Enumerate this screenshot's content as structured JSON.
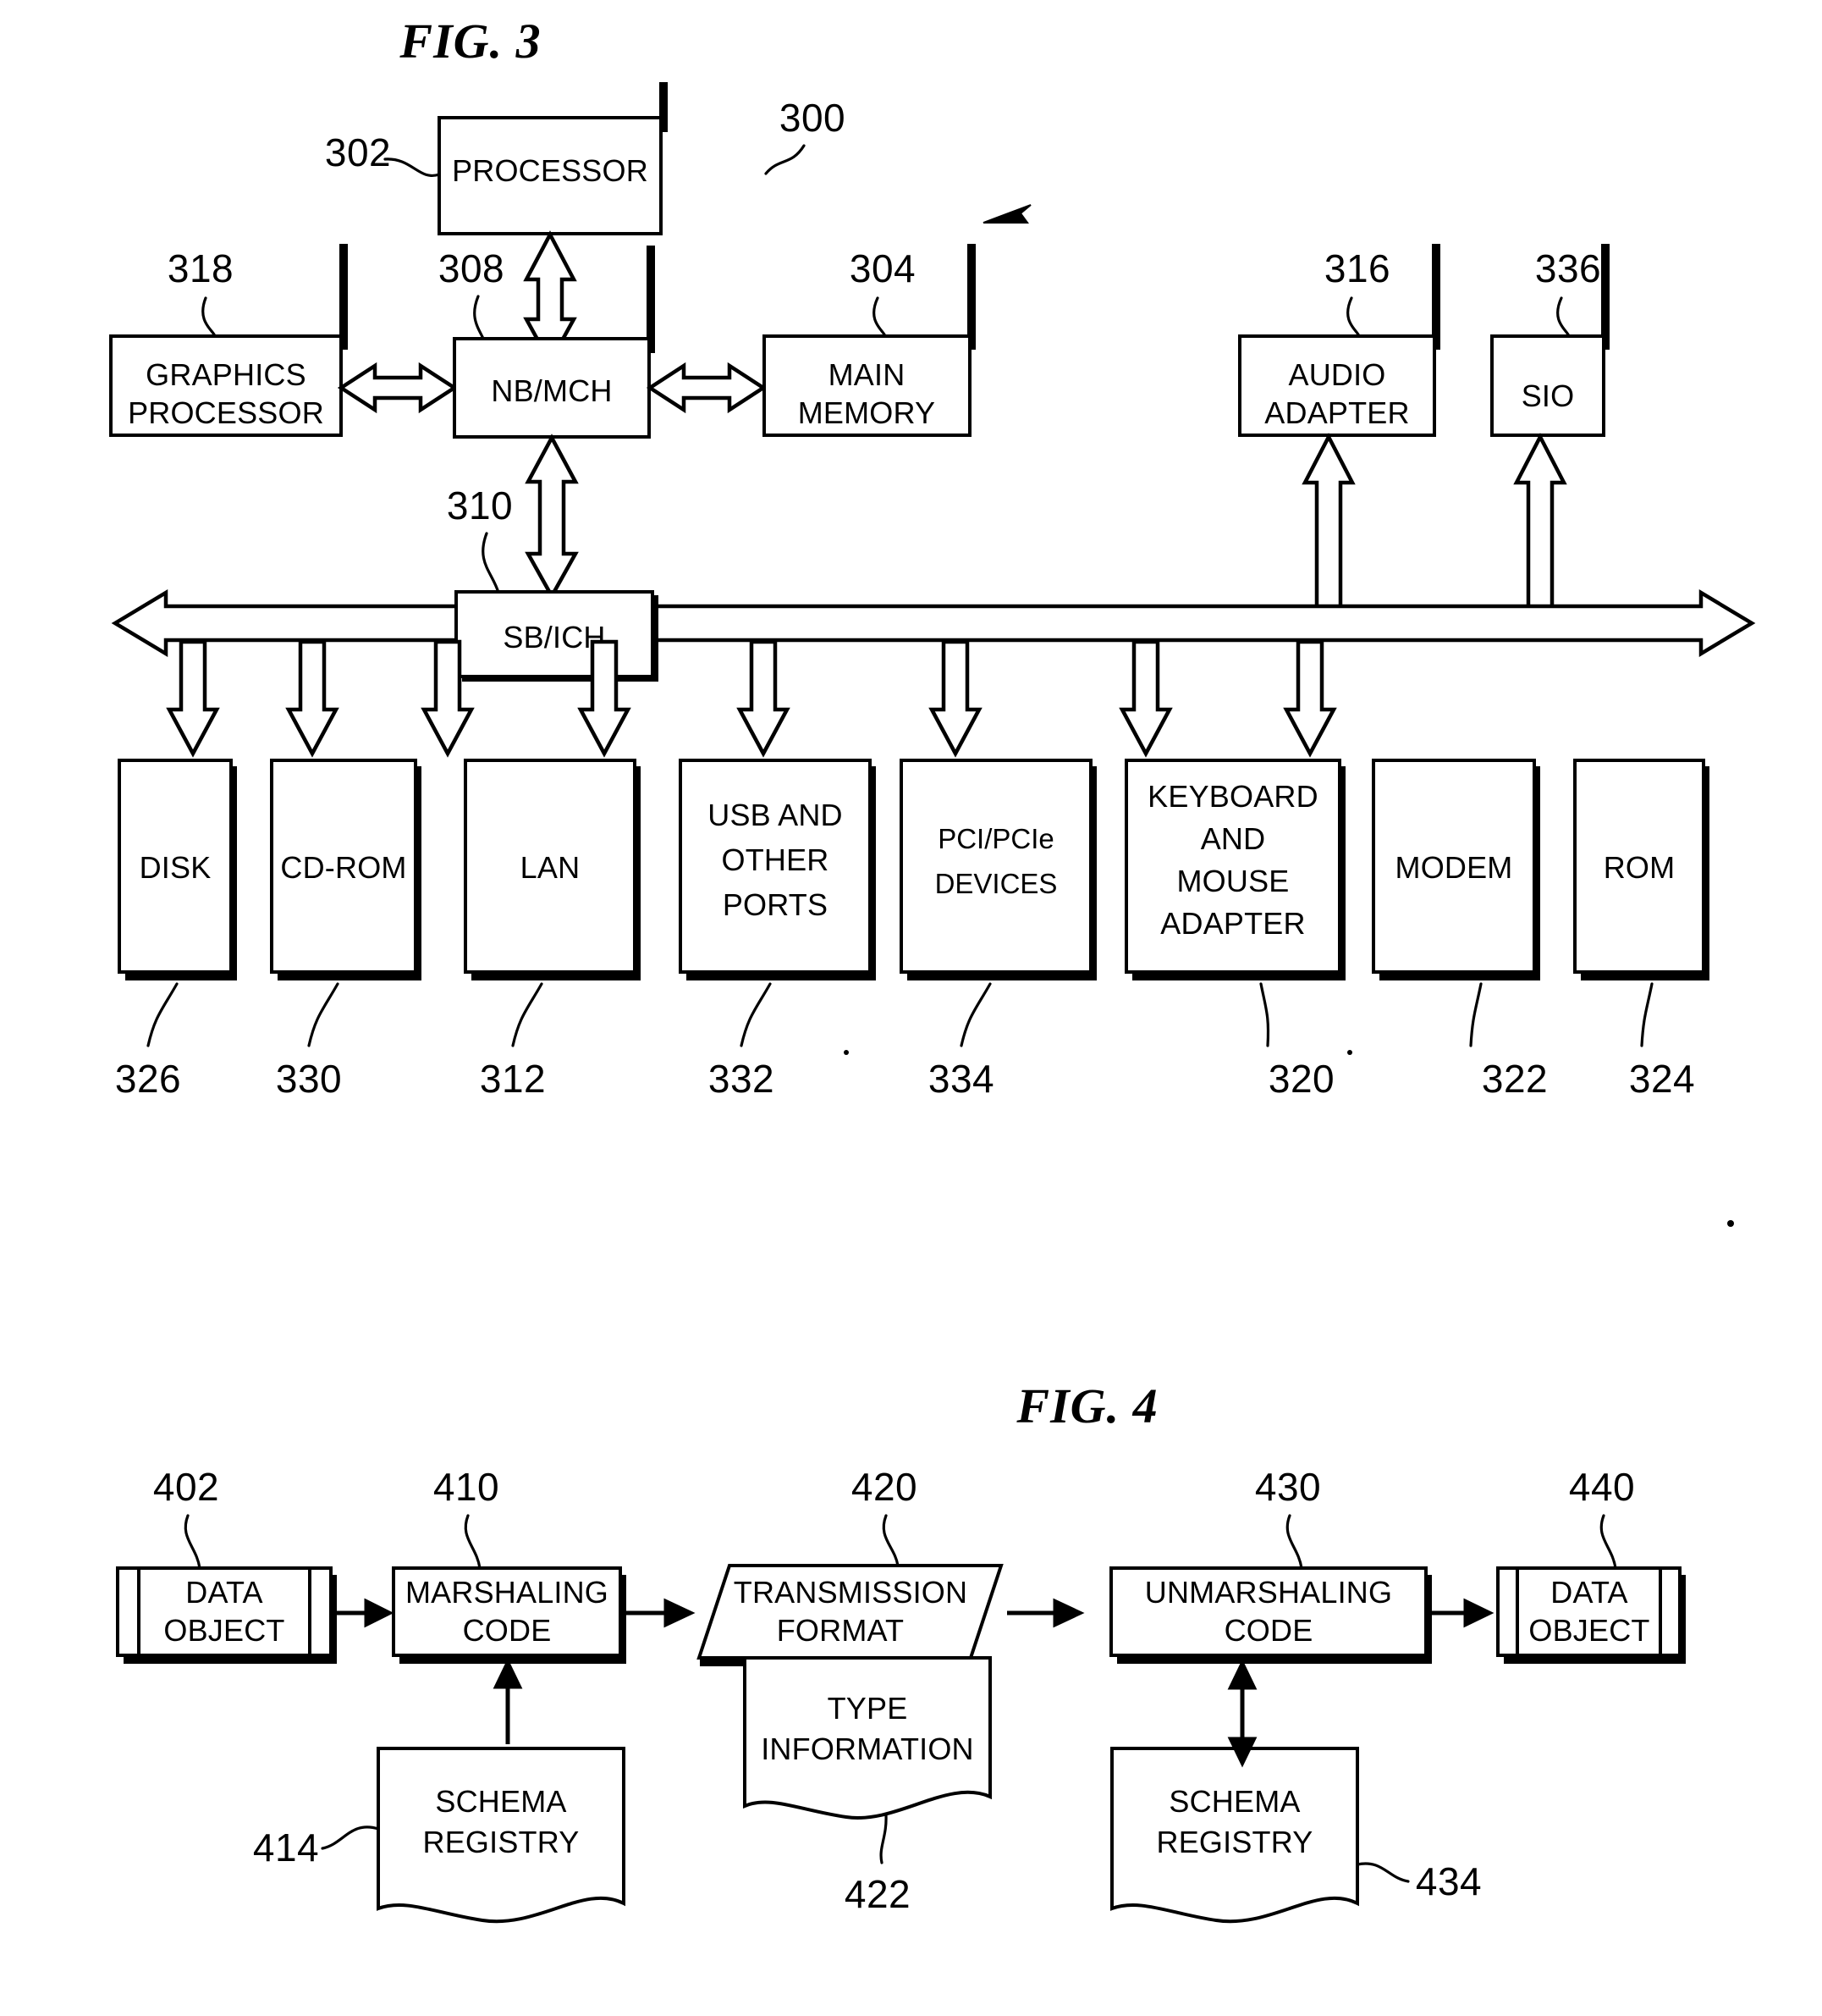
{
  "figures": [
    {
      "id": "fig3",
      "title": "FIG. 3",
      "system_ref": "300",
      "nodes": [
        {
          "key": "processor",
          "label": "PROCESSOR",
          "ref": "302"
        },
        {
          "key": "graphics",
          "label": "GRAPHICS\nPROCESSOR",
          "ref": "318"
        },
        {
          "key": "nbmch",
          "label": "NB/MCH",
          "ref": "308"
        },
        {
          "key": "mainmem",
          "label": "MAIN\nMEMORY",
          "ref": "304"
        },
        {
          "key": "audio",
          "label": "AUDIO\nADAPTER",
          "ref": "316"
        },
        {
          "key": "sio",
          "label": "SIO",
          "ref": "336"
        },
        {
          "key": "sbich",
          "label": "SB/ICH",
          "ref": "310"
        },
        {
          "key": "disk",
          "label": "DISK",
          "ref": "326"
        },
        {
          "key": "cdrom",
          "label": "CD-ROM",
          "ref": "330"
        },
        {
          "key": "lan",
          "label": "LAN",
          "ref": "312"
        },
        {
          "key": "usb",
          "label": "USB AND\nOTHER\nPORTS",
          "ref": "332"
        },
        {
          "key": "pci",
          "label": "PCI/PCIe\nDEVICES",
          "ref": "334"
        },
        {
          "key": "keyboard",
          "label": "KEYBOARD\nAND\nMOUSE\nADAPTER",
          "ref": "320"
        },
        {
          "key": "modem",
          "label": "MODEM",
          "ref": "322"
        },
        {
          "key": "rom",
          "label": "ROM",
          "ref": "324"
        }
      ]
    },
    {
      "id": "fig4",
      "title": "FIG. 4",
      "nodes": [
        {
          "key": "data_object_in",
          "label": "DATA\nOBJECT",
          "ref": "402"
        },
        {
          "key": "marshaling",
          "label": "MARSHALING\nCODE",
          "ref": "410"
        },
        {
          "key": "transmission",
          "label": "TRANSMISSION\nFORMAT",
          "ref": "420"
        },
        {
          "key": "unmarshaling",
          "label": "UNMARSHALING\nCODE",
          "ref": "430"
        },
        {
          "key": "data_object_out",
          "label": "DATA\nOBJECT",
          "ref": "440"
        },
        {
          "key": "schema_left",
          "label": "SCHEMA\nREGISTRY",
          "ref": "414"
        },
        {
          "key": "type_info",
          "label": "TYPE\nINFORMATION",
          "ref": "422"
        },
        {
          "key": "schema_right",
          "label": "SCHEMA\nREGISTRY",
          "ref": "434"
        }
      ]
    }
  ],
  "colors": {
    "ink": "#000000",
    "paper": "#ffffff"
  }
}
